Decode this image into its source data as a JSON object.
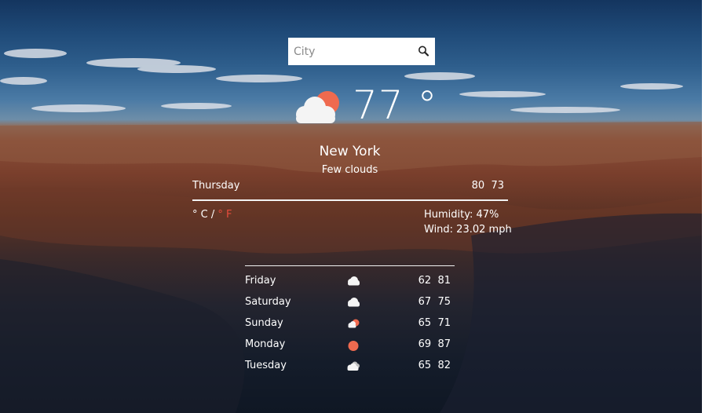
{
  "search": {
    "placeholder": "City",
    "icon": "magnifier-icon"
  },
  "current": {
    "icon": "partly-cloudy-icon",
    "temperature": "77 °",
    "city": "New York",
    "condition": "Few clouds",
    "day": "Thursday",
    "hi_lo": "80  73",
    "unit_celsius": "° C / ",
    "unit_fahrenheit": "° F",
    "humidity": "Humidity: 47%",
    "wind": "Wind: 23.02 mph"
  },
  "forecast": [
    {
      "day": "Friday",
      "icon": "cloud-icon",
      "hi_lo": "62  81"
    },
    {
      "day": "Saturday",
      "icon": "cloud-icon",
      "hi_lo": "67  75"
    },
    {
      "day": "Sunday",
      "icon": "partly-cloudy-icon",
      "hi_lo": "65  71"
    },
    {
      "day": "Monday",
      "icon": "sun-icon",
      "hi_lo": "69  87"
    },
    {
      "day": "Tuesday",
      "icon": "broken-clouds-icon",
      "hi_lo": "65  82"
    }
  ],
  "colors": {
    "accent": "#e74c3c",
    "sun": "#ef6a4f",
    "text": "#ffffff"
  }
}
